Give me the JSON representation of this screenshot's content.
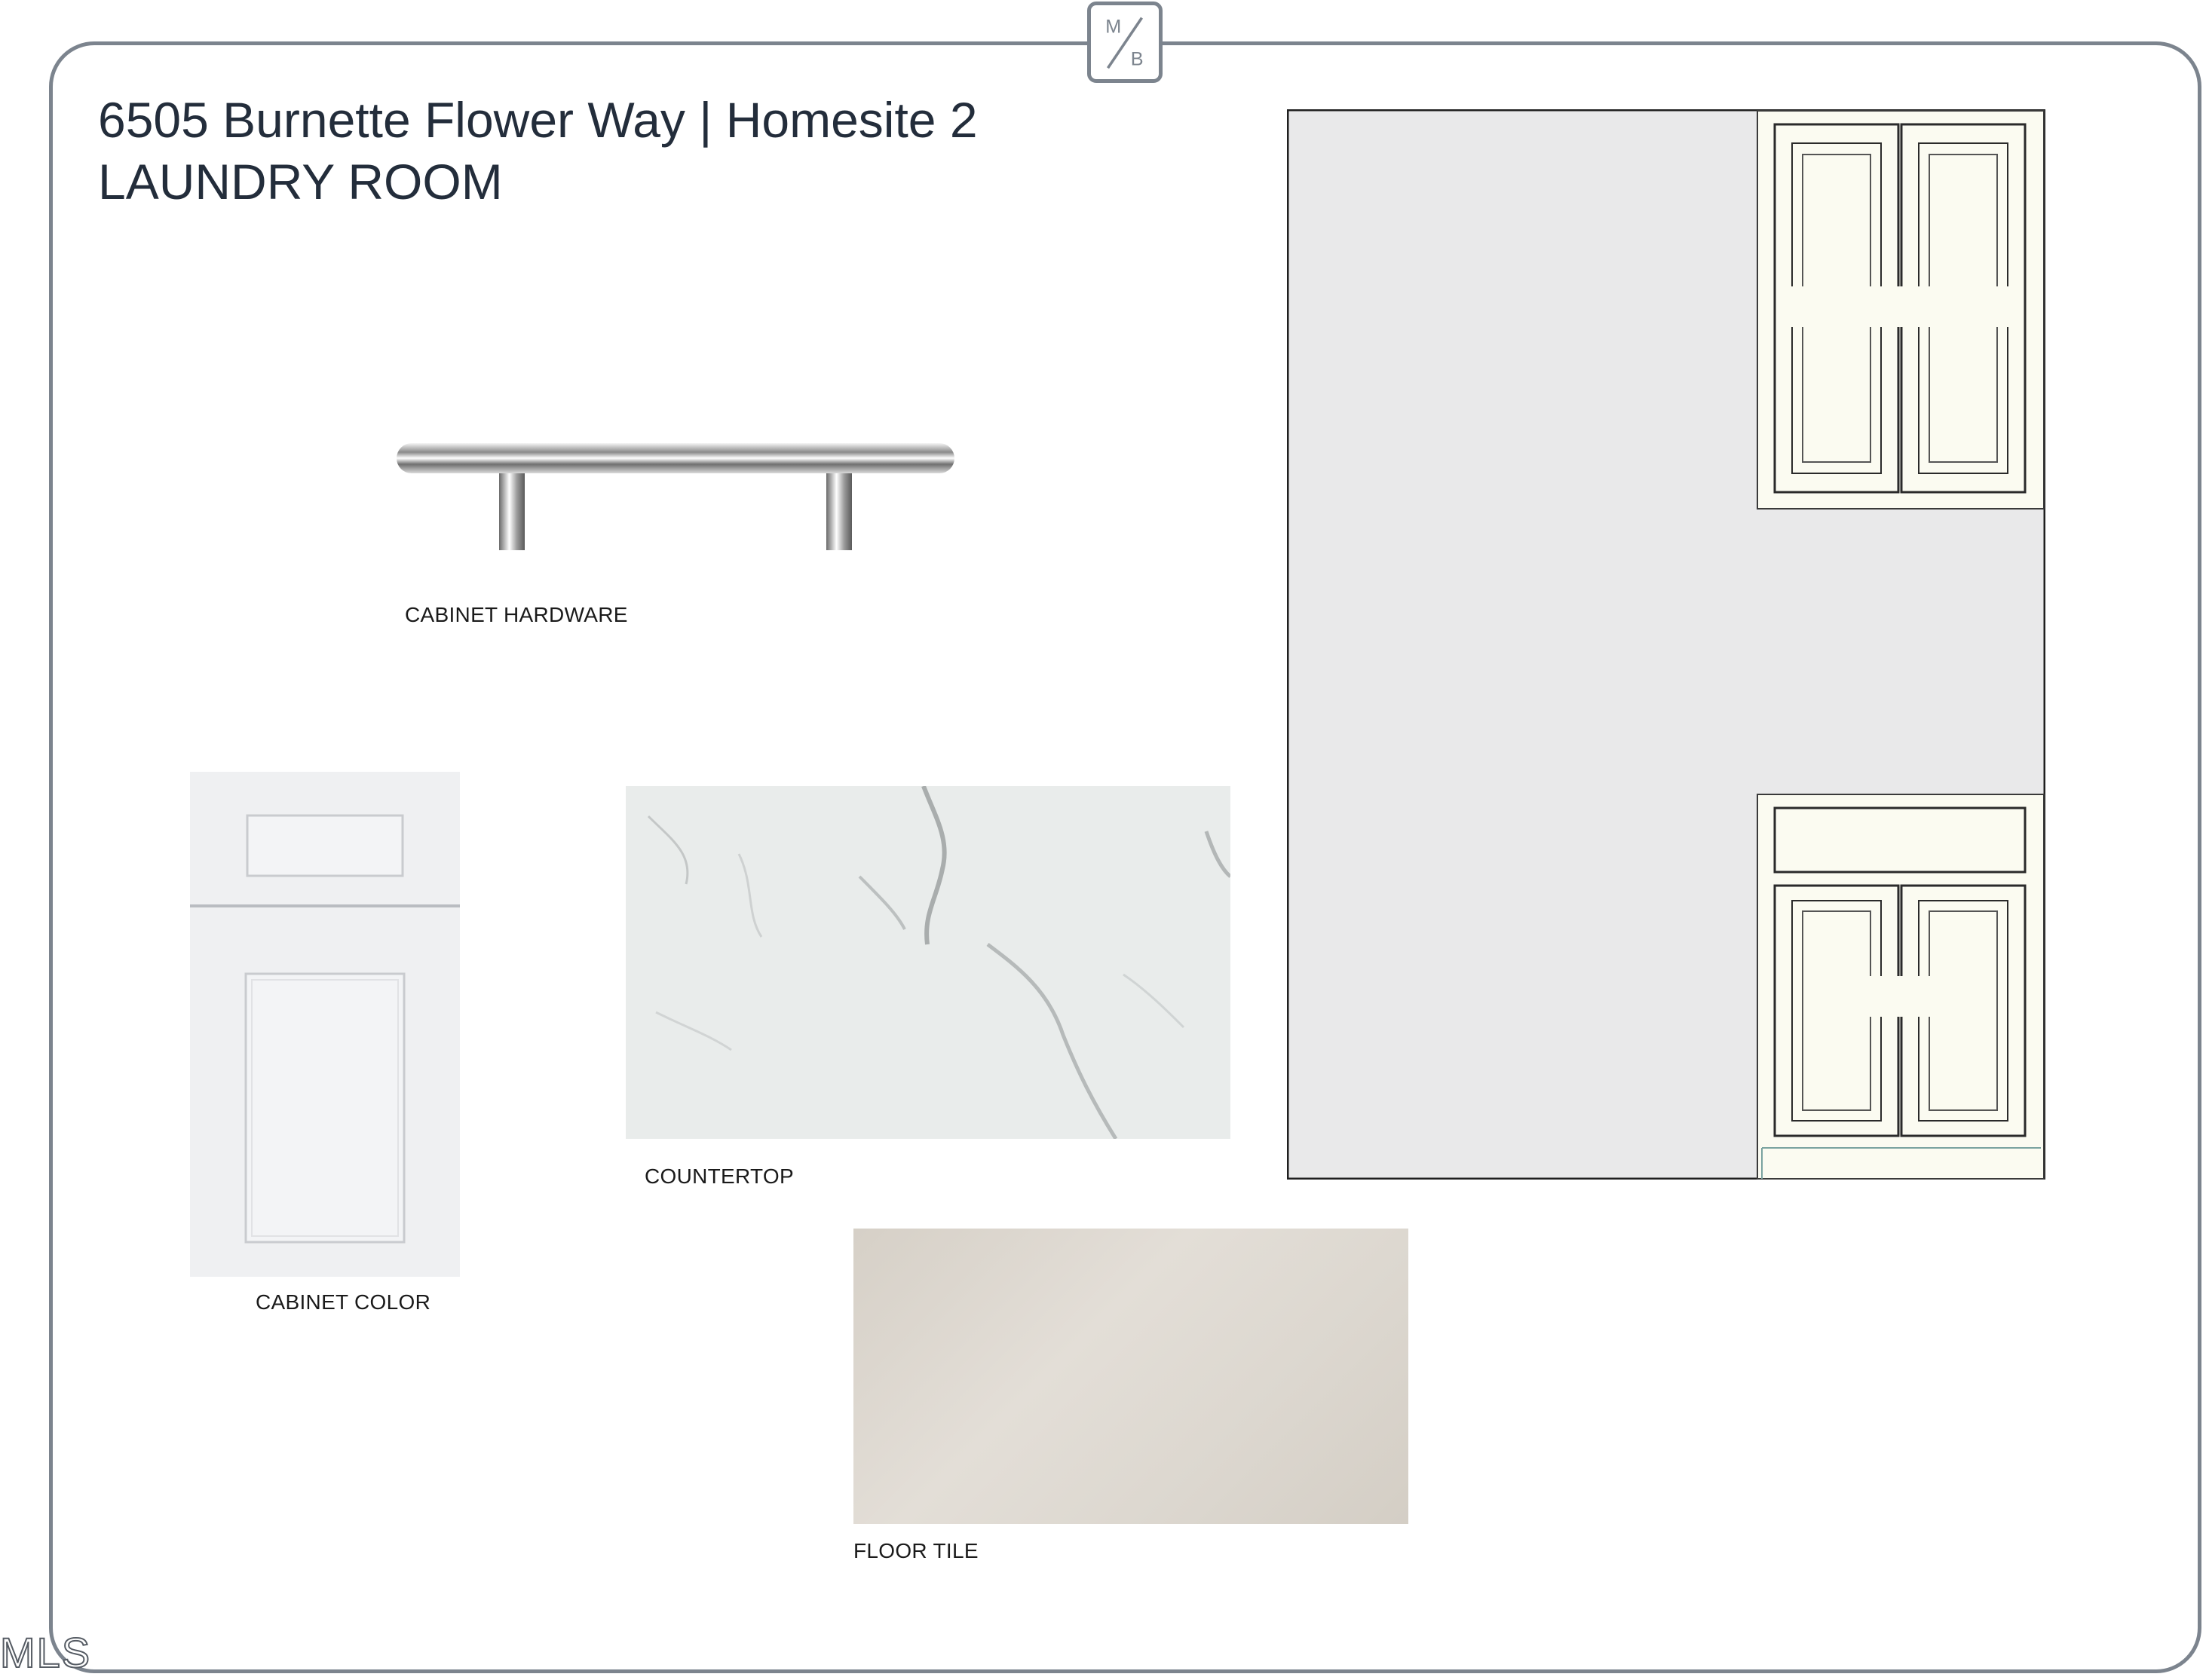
{
  "logo": {
    "top": "M",
    "bottom": "B"
  },
  "header": {
    "title": "6505 Burnette Flower Way | Homesite 2",
    "subtitle": "LAUNDRY ROOM"
  },
  "swatches": {
    "hardware": {
      "label": "CABINET HARDWARE"
    },
    "cabinet_color": {
      "label": "CABINET COLOR",
      "color": "#eff0f2"
    },
    "countertop": {
      "label": "COUNTERTOP",
      "color": "#e9eceb"
    },
    "floor_tile": {
      "label": "FLOOR TILE",
      "color": "#ddd8d0"
    }
  },
  "elevation": {
    "wall_color": "#e9e9ea",
    "cabinet_color": "#fbfbf1"
  },
  "watermark": {
    "text": "MLS"
  }
}
